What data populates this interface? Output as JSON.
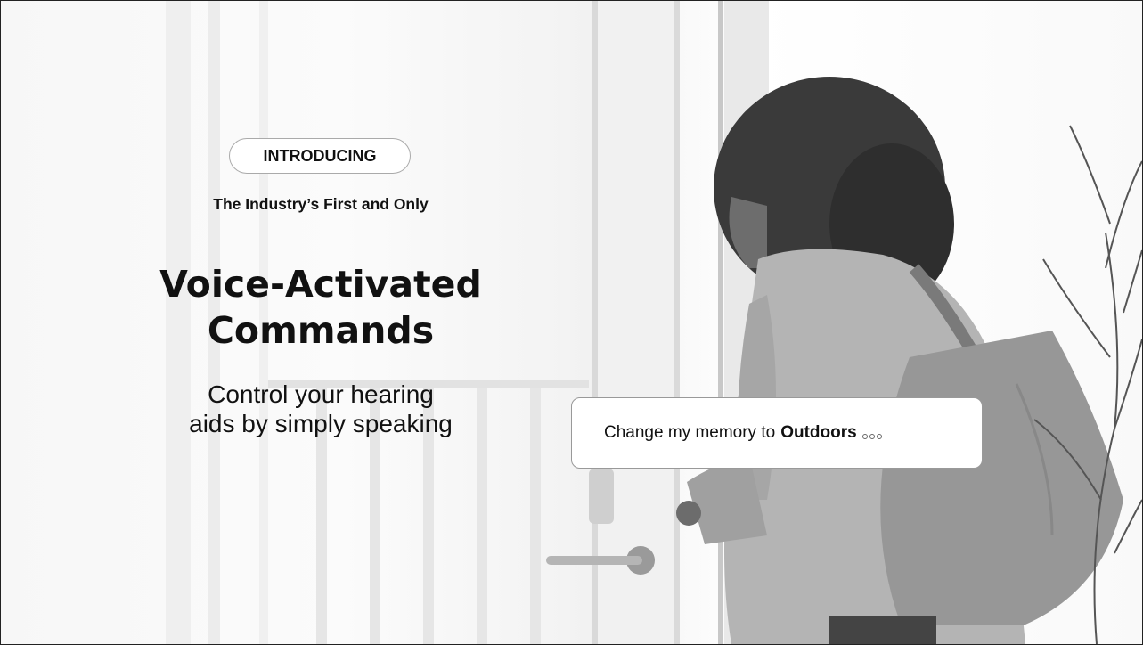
{
  "badge": "INTRODUCING",
  "subtitle": "The Industry’s First and Only",
  "title_line1": "Voice-Activated",
  "title_line2": "Commands",
  "desc_line1": "Control your hearing",
  "desc_line2": "aids by simply speaking",
  "bubble": {
    "prefix": "Change my memory to",
    "emphasis": "Outdoors"
  },
  "colors": {
    "text": "#111111",
    "background": "#f7f7f7"
  },
  "icons": {
    "typing": "typing-dots-icon"
  }
}
